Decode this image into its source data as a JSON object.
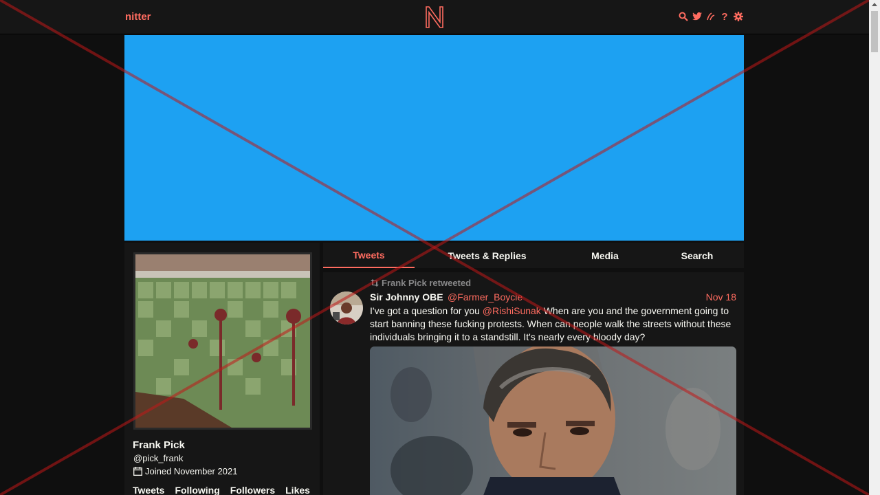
{
  "nav": {
    "logo_text": "nitter",
    "logo_mark": "N",
    "icons": [
      "search-icon",
      "twitter-icon",
      "rss-icon",
      "help-icon",
      "gear-icon"
    ]
  },
  "profile": {
    "name": "Frank Pick",
    "handle": "@pick_frank",
    "joined": "Joined November 2021",
    "stats": [
      "Tweets",
      "Following",
      "Followers",
      "Likes"
    ]
  },
  "tabs": {
    "tweets": "Tweets",
    "replies": "Tweets & Replies",
    "media": "Media",
    "search": "Search"
  },
  "tweet": {
    "retweeted_by": "Frank Pick retweeted",
    "author_name": "Sir Johnny OBE",
    "author_handle": "@Farmer_Boycie",
    "date": "Nov 18",
    "text_before": "I've got a question for you ",
    "mention": "@RishiSunak",
    "text_after": " When are you and the government going to start banning these fucking protests. When can people walk the streets without these individuals bringing it to a standstill. It's nearly every bloody day?"
  },
  "colors": {
    "accent": "#ff6c60",
    "banner": "#1da1f2",
    "background": "#0f0f0f",
    "panel": "#161616"
  }
}
